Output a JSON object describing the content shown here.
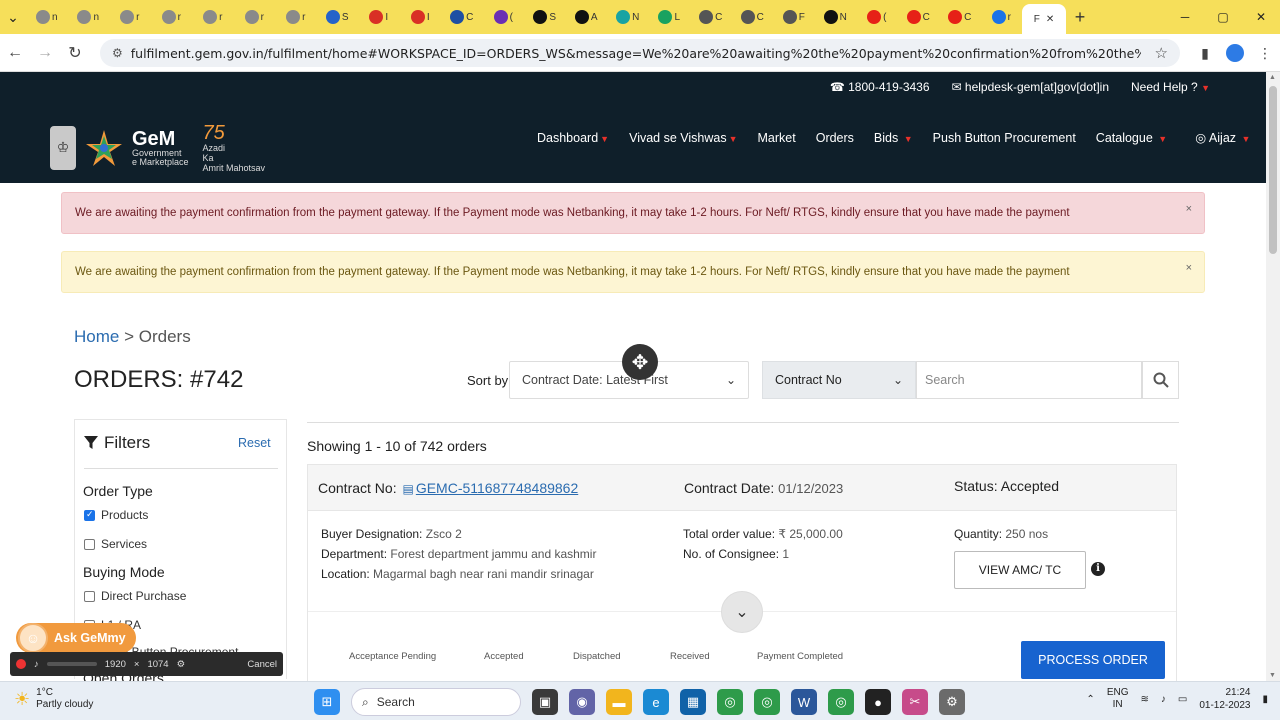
{
  "browser": {
    "tabs": [
      {
        "icon": "gem-icon",
        "color": "#8a8a8a",
        "label": "n"
      },
      {
        "icon": "gem-icon",
        "color": "#8a8a8a",
        "label": "n"
      },
      {
        "icon": "gem-icon",
        "color": "#8a8a8a",
        "label": "r"
      },
      {
        "icon": "gem-icon",
        "color": "#8a8a8a",
        "label": "r"
      },
      {
        "icon": "gem-icon",
        "color": "#8a8a8a",
        "label": "r"
      },
      {
        "icon": "gem-icon",
        "color": "#8a8a8a",
        "label": "r"
      },
      {
        "icon": "gem-icon",
        "color": "#8a8a8a",
        "label": "r"
      },
      {
        "icon": "gear-icon",
        "color": "#2563c9",
        "label": "S"
      },
      {
        "icon": "gmail-icon",
        "color": "#d93025",
        "label": "I"
      },
      {
        "icon": "gmail-icon",
        "color": "#d93025",
        "label": "I"
      },
      {
        "icon": "key-icon",
        "color": "#1e4fa3",
        "label": "C"
      },
      {
        "icon": "mail-icon",
        "color": "#6b2fb3",
        "label": "("
      },
      {
        "icon": "hp-icon",
        "color": "#111111",
        "label": "S"
      },
      {
        "icon": "hp-icon",
        "color": "#111111",
        "label": "A"
      },
      {
        "icon": "hp-icon",
        "color": "#19a3a3",
        "label": "N"
      },
      {
        "icon": "gem-icon",
        "color": "#1aa260",
        "label": "L"
      },
      {
        "icon": "globe-icon",
        "color": "#555555",
        "label": "C"
      },
      {
        "icon": "globe-icon",
        "color": "#555555",
        "label": "C"
      },
      {
        "icon": "globe-icon",
        "color": "#555555",
        "label": "F"
      },
      {
        "icon": "hp-icon",
        "color": "#111111",
        "label": "N"
      },
      {
        "icon": "youtube-icon",
        "color": "#e62117",
        "label": "("
      },
      {
        "icon": "youtube-icon",
        "color": "#e62117",
        "label": "C"
      },
      {
        "icon": "youtube-icon",
        "color": "#e62117",
        "label": "C"
      },
      {
        "icon": "info-icon",
        "color": "#1a73e8",
        "label": "r"
      }
    ],
    "active_tab": {
      "label": "F",
      "icon": "gem-icon"
    },
    "url": "fulfilment.gem.gov.in/fulfilment/home#WORKSPACE_ID=ORDERS_WS&message=We%20are%20awaiting%20the%20payment%20confirmation%20from%20the%20payment%20gateway.%20If%20..."
  },
  "header": {
    "phone": "1800-419-3436",
    "email": "helpdesk-gem[at]gov[dot]in",
    "need_help": "Need Help ?",
    "logo_big": "GeM",
    "logo_small1": "Government",
    "logo_small2": "e Marketplace",
    "azadi_num": "75",
    "azadi_text1": "Azadi",
    "azadi_text2": "Ka",
    "azadi_text3": "Amrit Mahotsav",
    "nav": {
      "dashboard": "Dashboard",
      "vivad": "Vivad se Vishwas",
      "market": "Market",
      "orders": "Orders",
      "bids": "Bids",
      "push": "Push Button Procurement",
      "catalogue": "Catalogue",
      "user": "Aijaz"
    }
  },
  "alerts": {
    "red": "We are awaiting the payment confirmation from the payment gateway. If the Payment mode was Netbanking, it may take 1-2 hours. For Neft/ RTGS, kindly ensure that you have made the payment",
    "yellow": "We are awaiting the payment confirmation from the payment gateway. If the Payment mode was Netbanking, it may take 1-2 hours. For Neft/ RTGS, kindly ensure that you have made the payment",
    "close": "×"
  },
  "breadcrumb": {
    "home": "Home",
    "sep": ">",
    "current": "Orders"
  },
  "title": {
    "prefix": "ORDERS:",
    "count": "#742"
  },
  "sort": {
    "label": "Sort by",
    "value": "Contract Date: Latest First"
  },
  "search": {
    "type": "Contract No",
    "placeholder": "Search"
  },
  "filters": {
    "title": "Filters",
    "reset": "Reset",
    "order_type": "Order Type",
    "products": "Products",
    "services": "Services",
    "buying_mode": "Buying Mode",
    "direct": "Direct Purchase",
    "l1": "L1 / RA",
    "push": "Push Button Procurement",
    "open_orders": "Open Orders"
  },
  "showing": "Showing 1 - 10 of 742 orders",
  "order": {
    "contract_label": "Contract No:",
    "contract_no": "GEMC-511687748489862",
    "date_label": "Contract Date:",
    "date": "01/12/2023",
    "status": "Status: Accepted",
    "buyer_label": "Buyer Designation:",
    "buyer": "Zsco 2",
    "dept_label": "Department:",
    "dept": "Forest department jammu and kashmir",
    "loc_label": "Location:",
    "loc": "Magarmal bagh near rani mandir srinagar",
    "value_label": "Total order value:",
    "value": "₹ 25,000.00",
    "consignee_label": "No. of Consignee:",
    "consignee": "1",
    "qty_label": "Quantity:",
    "qty": "250 nos",
    "amc_btn": "VIEW AMC/ TC",
    "steps": [
      "Acceptance Pending",
      "Accepted",
      "Dispatched",
      "Received",
      "Payment Completed"
    ],
    "process_btn": "PROCESS ORDER"
  },
  "overlay": {
    "ask_gemmy": "Ask GeMmy",
    "rec_w": "1920",
    "rec_x": "×",
    "rec_h": "1074",
    "rec_cancel": "Cancel"
  },
  "taskbar": {
    "temp": "1°C",
    "weather": "Partly cloudy",
    "search": "Search",
    "lang1": "ENG",
    "lang2": "IN",
    "time": "21:24",
    "date": "01-12-2023"
  }
}
